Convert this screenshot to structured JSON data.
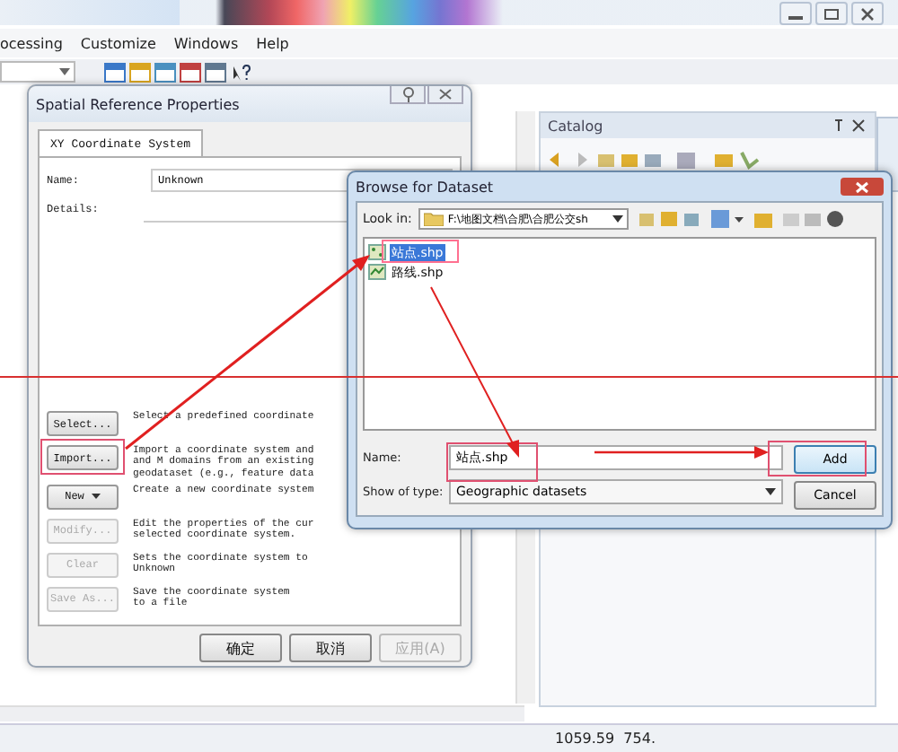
{
  "menu": [
    "ocessing",
    "Customize",
    "Windows",
    "Help"
  ],
  "spatial_dialog": {
    "title": "Spatial Reference Properties",
    "tabs": [
      {
        "label": "XY Coordinate System",
        "selected": true
      }
    ],
    "name_label": "Name:",
    "name_value": "Unknown",
    "details_label": "Details:",
    "actions": [
      {
        "label": "Select...",
        "kind": "button",
        "disabled": false,
        "description": "Select a predefined coordinate"
      },
      {
        "label": "Import...",
        "kind": "button",
        "disabled": false,
        "description": "Import a coordinate system and\nand M domains from an existing\ngeodataset (e.g., feature data"
      },
      {
        "label": "New",
        "kind": "dropdown",
        "disabled": false,
        "description": "Create a new coordinate system"
      },
      {
        "label": "Modify...",
        "kind": "button",
        "disabled": true,
        "description": "Edit the properties of the cur\nselected coordinate system."
      },
      {
        "label": "Clear",
        "kind": "button",
        "disabled": true,
        "description": "Sets the coordinate system to\nUnknown"
      },
      {
        "label": "Save As...",
        "kind": "button",
        "disabled": true,
        "description": "Save the coordinate system\nto a file"
      }
    ],
    "buttons": [
      {
        "label": "确定",
        "disabled": false
      },
      {
        "label": "取消",
        "disabled": false
      },
      {
        "label": "应用(A)",
        "disabled": true
      }
    ]
  },
  "catalog": {
    "title": "Catalog"
  },
  "browse_dialog": {
    "title": "Browse for Dataset",
    "look_in_label": "Look in:",
    "look_in_value": "F:\\地图文档\\合肥\\合肥公交sh",
    "files": [
      {
        "name": "站点.shp",
        "kind": "point",
        "selected": true
      },
      {
        "name": "路线.shp",
        "kind": "line",
        "selected": false
      }
    ],
    "name_label": "Name:",
    "name_value": "站点.shp",
    "type_label": "Show of type:",
    "type_value": "Geographic datasets",
    "buttons": [
      "Add",
      "Cancel"
    ]
  },
  "status_bar": {
    "coordinates": "1059.59  754."
  }
}
